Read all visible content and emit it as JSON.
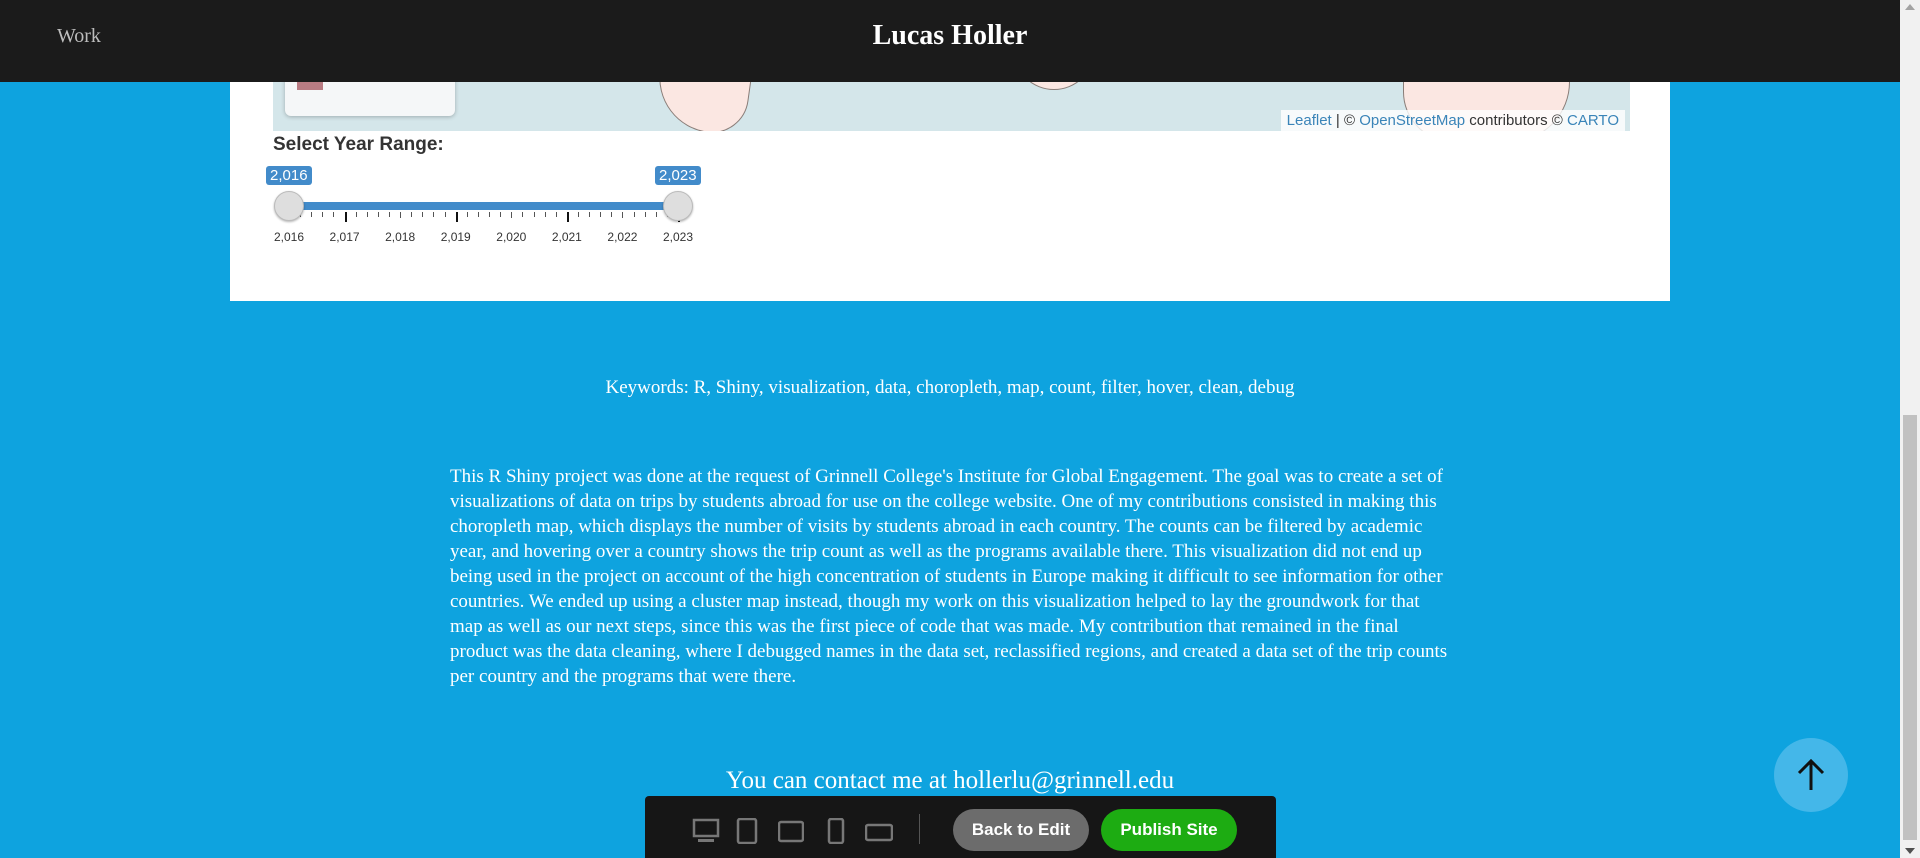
{
  "header": {
    "nav_work": "Work",
    "site_name": "Lucas Holler"
  },
  "map": {
    "attribution_leaflet": "Leaflet",
    "attribution_sep": "| ©",
    "attribution_osm": "OpenStreetMap",
    "attribution_contributors": "contributors ©",
    "attribution_carto": "CARTO",
    "legend_color": "#b97c83"
  },
  "slider": {
    "label": "Select Year Range:",
    "from_label": "2,016",
    "to_label": "2,023",
    "tick_labels": [
      "2,016",
      "2,017",
      "2,018",
      "2,019",
      "2,020",
      "2,021",
      "2,022",
      "2,023"
    ],
    "range": [
      2016,
      2023
    ],
    "selected": [
      2016,
      2023
    ]
  },
  "content": {
    "keywords": "Keywords: R, Shiny, visualization, data, choropleth, map, count, filter, hover, clean, debug",
    "description": "This R Shiny project was done at the request of Grinnell College's Institute for Global Engagement. The goal was to create a set of visualizations of data on trips by students abroad for use on the college website. One of my contributions consisted in making this choropleth map, which displays the number of visits by students abroad in each country. The counts can be filtered by academic year, and hovering over a country shows the trip count as well as the programs available there. This visualization did not end up being used in the project on account of the high concentration of students in Europe making it difficult to see information for other countries. We ended up using a cluster map instead, though my work on this visualization helped to lay the groundwork for that map as well as our next steps, since this was the first piece of code that was made. My contribution that remained in the final product was the data cleaning, where I debugged names in the data set, reclassified regions, and created a data set of the trip counts per country and the programs that were there.",
    "contact": "You can contact me at hollerlu@grinnell.edu"
  },
  "toolbar": {
    "devices": [
      "desktop-icon",
      "tablet-portrait-icon",
      "tablet-landscape-icon",
      "mobile-portrait-icon",
      "mobile-landscape-icon"
    ],
    "back_label": "Back to Edit",
    "publish_label": "Publish Site"
  },
  "colors": {
    "page_bg": "#0ea3df",
    "header_bg": "#1b1b1b",
    "slider_accent": "#428bca",
    "publish_green": "#1dac12"
  }
}
